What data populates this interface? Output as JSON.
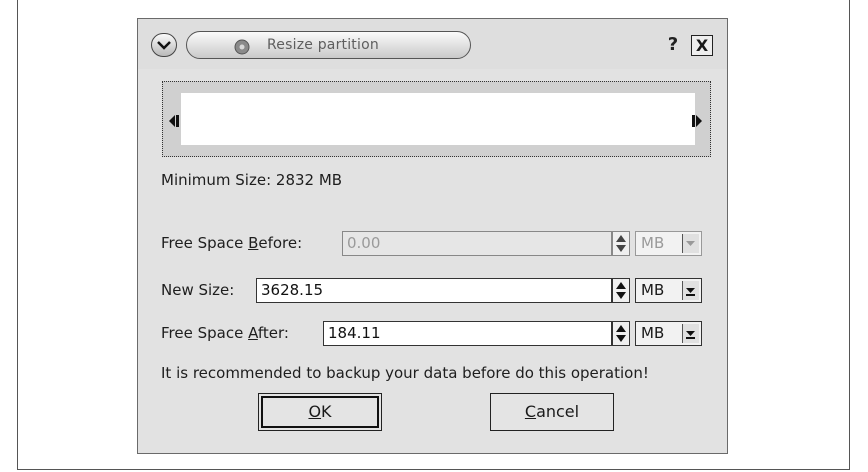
{
  "dialog": {
    "title": "Resize partition",
    "help_label": "?",
    "close_label": "X"
  },
  "info": {
    "minimum_size": "Minimum Size: 2832 MB"
  },
  "fields": {
    "free_before": {
      "label_pre": "Free Space ",
      "label_u": "B",
      "label_post": "efore:",
      "value": "0.00",
      "unit": "MB"
    },
    "new_size": {
      "label": "New Size:",
      "value": "3628.15",
      "unit": "MB"
    },
    "free_after": {
      "label_pre": "Free Space ",
      "label_u": "A",
      "label_post": "fter:",
      "value": "184.11",
      "unit": "MB"
    }
  },
  "warning": "It is recommended to backup your data before do this operation!",
  "buttons": {
    "ok_u": "O",
    "ok_rest": "K",
    "cancel_u": "C",
    "cancel_rest": "ancel"
  },
  "icons": [
    "menu-arrow-icon",
    "partition-icon",
    "help-icon",
    "close-icon",
    "left-handle-icon",
    "right-handle-icon",
    "spin-arrows-icon",
    "dropdown-arrow-icon"
  ]
}
